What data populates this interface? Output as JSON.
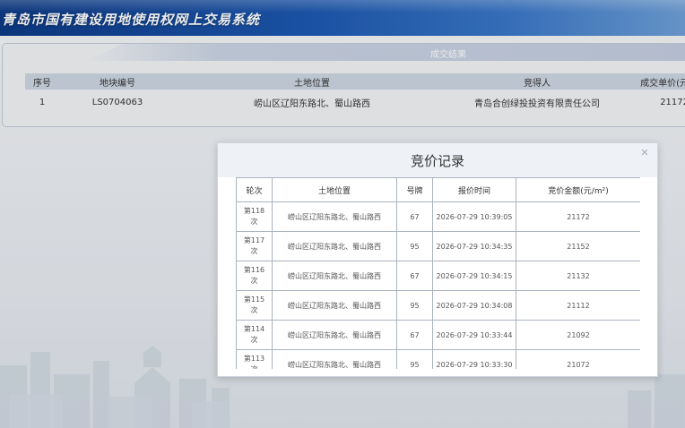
{
  "header": {
    "title": "青岛市国有建设用地使用权网上交易系统"
  },
  "result": {
    "title": "成交结果",
    "columns": [
      "序号",
      "地块编号",
      "土地位置",
      "竞得人",
      "成交单价(元"
    ],
    "rows": [
      [
        "1",
        "LS0704063",
        "崂山区辽阳东路北、蜀山路西",
        "青岛合创绿投投资有限责任公司",
        "21172"
      ]
    ]
  },
  "modal": {
    "title": "竞价记录",
    "close_icon": "close-icon",
    "columns": [
      "轮次",
      "土地位置",
      "号牌",
      "报价时间",
      "竞价金额(元/m²)"
    ],
    "rows": [
      {
        "round_a": "第118",
        "round_b": "次",
        "location": "崂山区辽阳东路北、蜀山路西",
        "plate": "67",
        "time": "2026-07-29 10:39:05",
        "amount": "21172"
      },
      {
        "round_a": "第117",
        "round_b": "次",
        "location": "崂山区辽阳东路北、蜀山路西",
        "plate": "95",
        "time": "2026-07-29 10:34:35",
        "amount": "21152"
      },
      {
        "round_a": "第116",
        "round_b": "次",
        "location": "崂山区辽阳东路北、蜀山路西",
        "plate": "67",
        "time": "2026-07-29 10:34:15",
        "amount": "21132"
      },
      {
        "round_a": "第115",
        "round_b": "次",
        "location": "崂山区辽阳东路北、蜀山路西",
        "plate": "95",
        "time": "2026-07-29 10:34:08",
        "amount": "21112"
      },
      {
        "round_a": "第114",
        "round_b": "次",
        "location": "崂山区辽阳东路北、蜀山路西",
        "plate": "67",
        "time": "2026-07-29 10:33:44",
        "amount": "21092"
      },
      {
        "round_a": "第113",
        "round_b": "次",
        "location": "崂山区辽阳东路北、蜀山路西",
        "plate": "95",
        "time": "2026-07-29 10:33:30",
        "amount": "21072"
      }
    ]
  },
  "colors": {
    "header_start": "#0d3a86",
    "header_end": "#6fa0d8",
    "table_header": "#ccd5e2",
    "modal_header": "#eef2f7"
  }
}
